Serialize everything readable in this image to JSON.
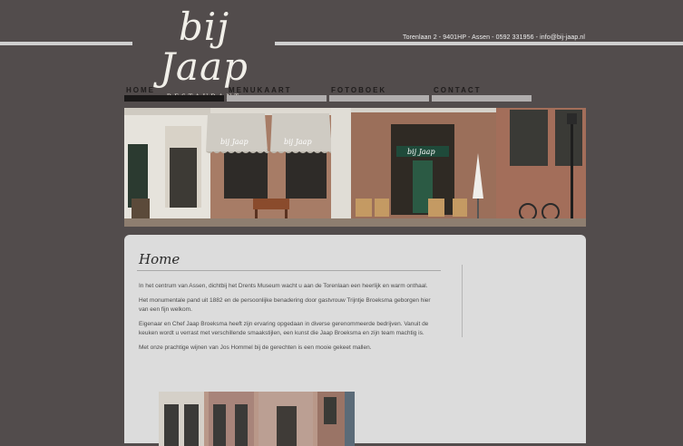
{
  "header": {
    "logo_main": "bij Jaap",
    "logo_sub": "RESTAURANT",
    "contact_info": "Torenlaan 2 - 9401HP - Assen - 0592 331956 - info@bij-jaap.nl"
  },
  "nav": {
    "items": [
      {
        "label": "HOME",
        "active": true
      },
      {
        "label": "MENUKAART",
        "active": false
      },
      {
        "label": "FOTOBOEK",
        "active": false
      },
      {
        "label": "CONTACT",
        "active": false
      }
    ]
  },
  "banner": {
    "awning_text": "bij Jaap",
    "door_sign": "bij Jaap"
  },
  "main": {
    "title": "Home",
    "paragraphs": [
      "In het centrum van Assen, dichtbij het Drents Museum wacht u aan de Torenlaan een heerlijk en warm onthaal.",
      "Het monumentale pand uit 1882 en de persoonlijke benadering door gastvrouw Trijntje Broeksma geborgen hier van een fijn welkom.",
      "Eigenaar en Chef Jaap Broeksma heeft zijn ervaring opgedaan in diverse gerenommeerde bedrijven. Vanuit de keuken wordt u verrast met verschillende smaakstijlen, een kunst die Jaap Broeksma en zijn team machtig is.",
      "Met onze prachtige wijnen van Jos Hommel bij de gerechten is een mooie gekeet mallen."
    ]
  },
  "colors": {
    "background": "#524c4c",
    "content_bg": "#dcdcdc",
    "nav_active": "#1a1818",
    "nav_inactive": "#b1aeae"
  }
}
